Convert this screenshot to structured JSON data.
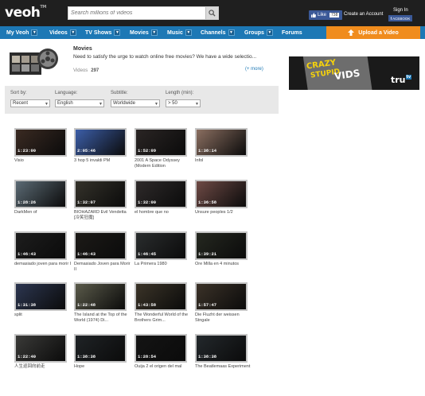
{
  "header": {
    "logo": "veoh",
    "logo_tm": "TM",
    "search_placeholder": "Search millions of videos",
    "like_label": "Like",
    "like_count": "738",
    "create_account": "Create an Account",
    "sign_in": "Sign In",
    "facebook_button": "ACEBOOK"
  },
  "nav": {
    "items": [
      "My Veoh",
      "Videos",
      "TV Shows",
      "Movies",
      "Music",
      "Channels",
      "Groups",
      "Forums"
    ],
    "dropdown_glyph": "▼",
    "upload": "Upload a Video"
  },
  "category": {
    "title": "Movies",
    "description": "Need to satisfy the urge to watch online free movies? We have a wide selectio...",
    "videos_label": "Videos",
    "videos_count": "297",
    "more": "(+ more)"
  },
  "filters": {
    "sort_label": "Sort by:",
    "sort_value": "Recent",
    "language_label": "Language:",
    "language_value": "English",
    "subtitle_label": "Subtitle:",
    "subtitle_value": "Worldwide",
    "length_label": "Length (min):",
    "length_value": "> 50"
  },
  "ad": {
    "line1": "CRAZY",
    "line2": "STUPID",
    "line3": "VIDS",
    "brand": "tru",
    "brand_tag": "tv"
  },
  "videos": [
    {
      "duration": "1:23:00",
      "title": "Visio",
      "tone": "#3a2a22"
    },
    {
      "duration": "2:05:46",
      "title": "3 hop 5 invaldi PM",
      "tone": "#3c5ea8"
    },
    {
      "duration": "1:52:09",
      "title": "2001 A Space Odyssey (Modern Edition",
      "tone": "#2a2524"
    },
    {
      "duration": "1:38:14",
      "title": "Infol",
      "tone": "#8a6e60"
    },
    {
      "duration": "1:28:26",
      "title": "DarkMen of",
      "tone": "#5b6a74"
    },
    {
      "duration": "1:32:07",
      "title": "BIOHAZARD Evil Vendetta [冷笑狂魔]",
      "tone": "#34322a"
    },
    {
      "duration": "1:32:00",
      "title": "el hombre que no",
      "tone": "#2e2a2a"
    },
    {
      "duration": "1:36:58",
      "title": "Unsure peoples 1/2",
      "tone": "#6e4a45"
    },
    {
      "duration": "1:46:43",
      "title": "demasiado joven para morir I",
      "tone": "#1d1d1d"
    },
    {
      "duration": "1:46:43",
      "title": "Demasiado Joven para Morir II",
      "tone": "#1c1a17"
    },
    {
      "duration": "1:46:45",
      "title": "La Primera 1980",
      "tone": "#2a2d2e"
    },
    {
      "duration": "1:39:21",
      "title": "Ore Milla en 4 minutos",
      "tone": "#252820"
    },
    {
      "duration": "1:31:38",
      "title": "split",
      "tone": "#2c3650"
    },
    {
      "duration": "1:22:48",
      "title": "The Island at the Top of the World (1974) Di...",
      "tone": "#5a5a4a"
    },
    {
      "duration": "1:43:58",
      "title": "The Wonderful World of the Brothers Grim...",
      "tone": "#3b3428"
    },
    {
      "duration": "1:57:47",
      "title": "Die Fluzht der weissen Stngale",
      "tone": "#3b3228"
    },
    {
      "duration": "1:22:40",
      "title": "人生巡回向前走",
      "tone": "#3a3a38"
    },
    {
      "duration": "1:38:38",
      "title": "Hope",
      "tone": "#1f2326"
    },
    {
      "duration": "1:28:54",
      "title": "Ouija 2 el origen del mal",
      "tone": "#141414"
    },
    {
      "duration": "1:38:38",
      "title": "The Beatlemaas Experiment",
      "tone": "#23282c"
    }
  ]
}
